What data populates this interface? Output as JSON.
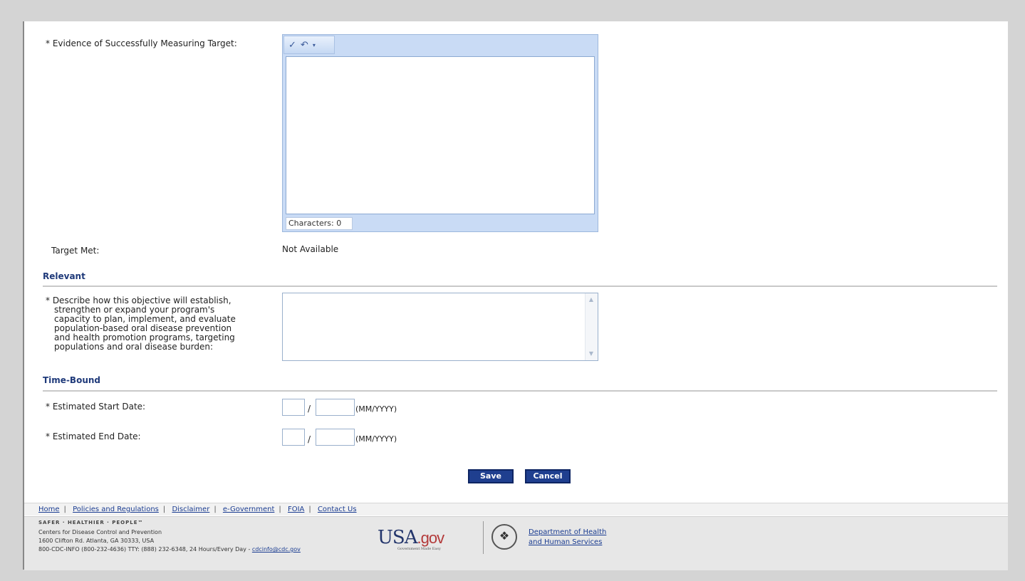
{
  "fields": {
    "evidence_label": "* Evidence of Successfully Measuring Target:",
    "characters_label": "Characters: 0",
    "target_met_label": "Target Met:",
    "target_met_value": "Not Available",
    "relevant_heading": "Relevant",
    "describe_label_lines": [
      "* Describe how this objective will establish,",
      "strengthen or expand your program's",
      "capacity to plan, implement, and evaluate",
      "population-based oral disease prevention",
      "and health promotion programs, targeting",
      "populations and oral disease burden:"
    ],
    "timebound_heading": "Time-Bound",
    "start_date_label": "* Estimated Start Date:",
    "end_date_label": "* Estimated End Date:",
    "date_slash": "/",
    "date_format": "(MM/YYYY)"
  },
  "buttons": {
    "save": "Save",
    "cancel": "Cancel"
  },
  "footer": {
    "links": [
      "Home",
      "Policies and Regulations",
      "Disclaimer",
      "e-Government",
      "FOIA",
      "Contact Us"
    ],
    "separator": "|",
    "tagline": "SAFER · HEALTHIER · PEOPLE™",
    "org": "Centers for Disease Control and Prevention",
    "address": "1600 Clifton Rd. Atlanta, GA 30333, USA",
    "contact": "800-CDC-INFO (800-232-4636) TTY: (888) 232-6348, 24 Hours/Every Day - ",
    "email": "cdcinfo@cdc.gov",
    "usa_gov_logo": {
      "main": "USA",
      "gov": ".gov",
      "sub": "Government Made Easy"
    },
    "hhs_line1": "Department of Health",
    "hhs_line2": "and Human Services"
  },
  "icons": {
    "spellcheck": "spellcheck-icon",
    "undo": "undo-icon",
    "dropdown": "chevron-down-icon"
  }
}
